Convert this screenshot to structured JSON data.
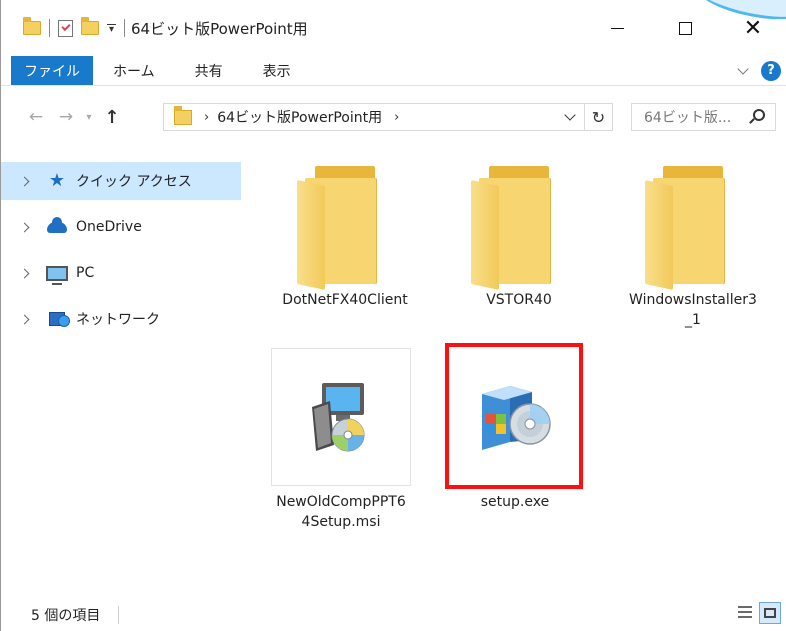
{
  "window": {
    "title": "64ビット版PowerPoint用"
  },
  "ribbon": {
    "tabs": [
      "ファイル",
      "ホーム",
      "共有",
      "表示"
    ],
    "active_tab_color": "#1979ca"
  },
  "navigation": {
    "breadcrumb": [
      "64ビット版PowerPoint用"
    ],
    "search_placeholder": "64ビット版..."
  },
  "sidebar": {
    "items": [
      {
        "label": "クイック アクセス",
        "icon": "star-icon",
        "selected": true
      },
      {
        "label": "OneDrive",
        "icon": "cloud-icon",
        "selected": false
      },
      {
        "label": "PC",
        "icon": "computer-icon",
        "selected": false
      },
      {
        "label": "ネットワーク",
        "icon": "network-icon",
        "selected": false
      }
    ],
    "selected_color": "#cce8ff"
  },
  "files": [
    {
      "name": "DotNetFX40Client",
      "type": "folder"
    },
    {
      "name": "VSTOR40",
      "type": "folder"
    },
    {
      "name": "WindowsInstaller3_1",
      "type": "folder"
    },
    {
      "name": "NewOldCompPPT64Setup.msi",
      "type": "msi-installer"
    },
    {
      "name": "setup.exe",
      "type": "setup-exe",
      "highlighted": true
    }
  ],
  "status": {
    "item_count": "5 個の項目"
  },
  "colors": {
    "highlight_border": "#ff1010",
    "folder": "#f7d671"
  }
}
